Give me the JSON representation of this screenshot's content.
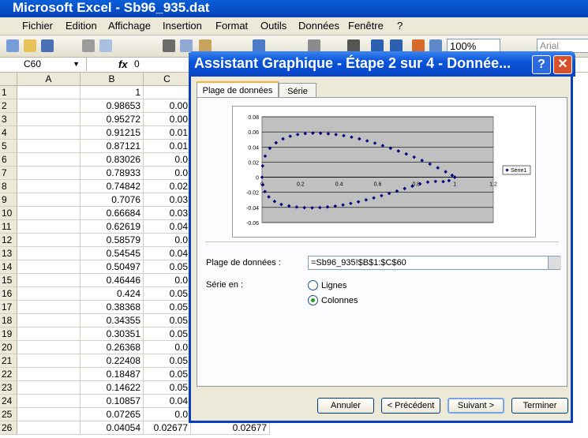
{
  "app": {
    "title": "Microsoft Excel - Sb96_935.dat"
  },
  "menu": [
    "Fichier",
    "Edition",
    "Affichage",
    "Insertion",
    "Format",
    "Outils",
    "Données",
    "Fenêtre",
    "?"
  ],
  "toolbar": {
    "zoom": "100%",
    "font": "Arial"
  },
  "formula_bar": {
    "cell_ref": "C60",
    "fx": "fx",
    "value": "0"
  },
  "columns": [
    "A",
    "B",
    "C"
  ],
  "rows": [
    {
      "n": "1",
      "b": "1",
      "c": ""
    },
    {
      "n": "2",
      "b": "0.98653",
      "c": "0.00"
    },
    {
      "n": "3",
      "b": "0.95272",
      "c": "0.00"
    },
    {
      "n": "4",
      "b": "0.91215",
      "c": "0.01"
    },
    {
      "n": "5",
      "b": "0.87121",
      "c": "0.01"
    },
    {
      "n": "6",
      "b": "0.83026",
      "c": "0.0"
    },
    {
      "n": "7",
      "b": "0.78933",
      "c": "0.0"
    },
    {
      "n": "8",
      "b": "0.74842",
      "c": "0.02"
    },
    {
      "n": "9",
      "b": "0.7076",
      "c": "0.03"
    },
    {
      "n": "10",
      "b": "0.66684",
      "c": "0.03"
    },
    {
      "n": "11",
      "b": "0.62619",
      "c": "0.04"
    },
    {
      "n": "12",
      "b": "0.58579",
      "c": "0.0"
    },
    {
      "n": "13",
      "b": "0.54545",
      "c": "0.04"
    },
    {
      "n": "14",
      "b": "0.50497",
      "c": "0.05"
    },
    {
      "n": "15",
      "b": "0.46446",
      "c": "0.0"
    },
    {
      "n": "16",
      "b": "0.424",
      "c": "0.05"
    },
    {
      "n": "17",
      "b": "0.38368",
      "c": "0.05"
    },
    {
      "n": "18",
      "b": "0.34355",
      "c": "0.05"
    },
    {
      "n": "19",
      "b": "0.30351",
      "c": "0.05"
    },
    {
      "n": "20",
      "b": "0.26368",
      "c": "0.0"
    },
    {
      "n": "21",
      "b": "0.22408",
      "c": "0.05"
    },
    {
      "n": "22",
      "b": "0.18487",
      "c": "0.05"
    },
    {
      "n": "23",
      "b": "0.14622",
      "c": "0.05"
    },
    {
      "n": "24",
      "b": "0.10857",
      "c": "0.04"
    },
    {
      "n": "25",
      "b": "0.07265",
      "c": "0.0"
    },
    {
      "n": "26",
      "b": "0.04054",
      "c": "0.02677",
      "d": "0.02677"
    }
  ],
  "dialog": {
    "title": "Assistant Graphique - Étape 2 sur 4 - Donnée...",
    "help": "?",
    "close": "✕",
    "tabs": [
      "Plage de données",
      "Série"
    ],
    "range_label": "Plage de données :",
    "range_value": "=Sb96_935!$B$1:$C$60",
    "series_in_label": "Série en :",
    "opt_rows": "Lignes",
    "opt_cols": "Colonnes",
    "selected": "Colonnes",
    "buttons": {
      "cancel": "Annuler",
      "prev": "< Précédent",
      "next": "Suivant >",
      "finish": "Terminer"
    }
  },
  "chart_data": {
    "type": "scatter",
    "xlim": [
      0,
      1.2
    ],
    "ylim": [
      -0.06,
      0.08
    ],
    "xticks": [
      "0",
      "0.2",
      "0.4",
      "0.6",
      "0.8",
      "1",
      "1.2"
    ],
    "yticks": [
      "0.08",
      "0.06",
      "0.04",
      "0.02",
      "0",
      "-0.02",
      "-0.04",
      "-0.06"
    ],
    "legend": "Série1",
    "plot_bg": "#c0c0c0",
    "marker_color": "#000080",
    "series": [
      {
        "name": "Série1",
        "x": [
          1,
          0.98653,
          0.95272,
          0.91215,
          0.87121,
          0.83026,
          0.78933,
          0.74842,
          0.7076,
          0.66684,
          0.62619,
          0.58579,
          0.54545,
          0.50497,
          0.46446,
          0.424,
          0.38368,
          0.34355,
          0.30351,
          0.26368,
          0.22408,
          0.18487,
          0.14622,
          0.10857,
          0.07265,
          0.04054,
          0.0161,
          0.003,
          0,
          0.004,
          0.015,
          0.035,
          0.065,
          0.1,
          0.14,
          0.18,
          0.22,
          0.26,
          0.3,
          0.34,
          0.38,
          0.42,
          0.46,
          0.5,
          0.54,
          0.58,
          0.62,
          0.66,
          0.7,
          0.74,
          0.78,
          0.82,
          0.86,
          0.9,
          0.94,
          0.97,
          1
        ],
        "y": [
          0,
          0.0025,
          0.0072,
          0.0125,
          0.0175,
          0.0222,
          0.0266,
          0.0308,
          0.0347,
          0.0384,
          0.0418,
          0.0451,
          0.0481,
          0.0508,
          0.0531,
          0.055,
          0.0565,
          0.0576,
          0.0582,
          0.0583,
          0.0578,
          0.0565,
          0.0543,
          0.0508,
          0.0456,
          0.0383,
          0.028,
          0.015,
          0,
          -0.01,
          -0.019,
          -0.026,
          -0.032,
          -0.036,
          -0.038,
          -0.0395,
          -0.0403,
          -0.0405,
          -0.0402,
          -0.0394,
          -0.0382,
          -0.0366,
          -0.0347,
          -0.0325,
          -0.03,
          -0.0273,
          -0.0244,
          -0.0214,
          -0.0183,
          -0.015,
          -0.0118,
          -0.0088,
          -0.0065,
          -0.0055,
          -0.0058,
          -0.0045,
          0
        ]
      }
    ]
  }
}
